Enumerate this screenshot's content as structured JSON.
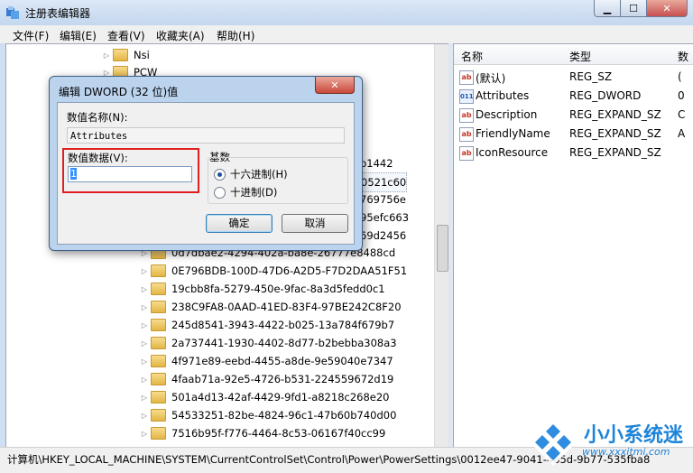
{
  "window": {
    "title": "注册表编辑器",
    "min": "▁",
    "max": "☐",
    "close": "✕"
  },
  "menu": [
    "文件(F)",
    "编辑(E)",
    "查看(V)",
    "收藏夹(A)",
    "帮助(H)"
  ],
  "tree": {
    "top_items": [
      "Nsi",
      "PCW"
    ],
    "partial_items": [
      "b1442",
      "0521c60",
      "769756e",
      "95efc663",
      "69d2456"
    ],
    "items": [
      "0d7dbae2-4294-402a-ba8e-26777e8488cd",
      "0E796BDB-100D-47D6-A2D5-F7D2DAA51F51",
      "19cbb8fa-5279-450e-9fac-8a3d5fedd0c1",
      "238C9FA8-0AAD-41ED-83F4-97BE242C8F20",
      "245d8541-3943-4422-b025-13a784f679b7",
      "2a737441-1930-4402-8d77-b2bebba308a3",
      "4f971e89-eebd-4455-a8de-9e59040e7347",
      "4faab71a-92e5-4726-b531-224559672d19",
      "501a4d13-42af-4429-9fd1-a8218c268e20",
      "54533251-82be-4824-96c1-47b60b740d00",
      "7516b95f-f776-4464-8c53-06167f40cc99"
    ]
  },
  "list": {
    "headers": {
      "name": "名称",
      "type": "类型",
      "data": "数"
    },
    "rows": [
      {
        "name": "(默认)",
        "type": "REG_SZ",
        "data": "(",
        "icon": "string-value-icon"
      },
      {
        "name": "Attributes",
        "type": "REG_DWORD",
        "data": "0",
        "icon": "dword-value-icon"
      },
      {
        "name": "Description",
        "type": "REG_EXPAND_SZ",
        "data": "C",
        "icon": "string-value-icon"
      },
      {
        "name": "FriendlyName",
        "type": "REG_EXPAND_SZ",
        "data": "A",
        "icon": "string-value-icon"
      },
      {
        "name": "IconResource",
        "type": "REG_EXPAND_SZ",
        "data": "",
        "icon": "string-value-icon"
      }
    ]
  },
  "dialog": {
    "title": "编辑 DWORD (32 位)值",
    "close": "✕",
    "name_label": "数值名称(N):",
    "name_value": "Attributes",
    "data_label": "数值数据(V):",
    "data_value": "1",
    "base_label": "基数",
    "hex_label": "十六进制(H)",
    "dec_label": "十进制(D)",
    "selected_base": "hex",
    "ok": "确定",
    "cancel": "取消"
  },
  "statusbar": {
    "path": "计算机\\HKEY_LOCAL_MACHINE\\SYSTEM\\CurrentControlSet\\Control\\Power\\PowerSettings\\0012ee47-9041-4b5d-9b77-535fba8"
  },
  "watermark": {
    "text": "小小系统迷",
    "url": "www.xxxitmi.com"
  },
  "colors": {
    "accent": "#1e84d8",
    "highlight": "#e02020",
    "selection": "#3390ff"
  }
}
